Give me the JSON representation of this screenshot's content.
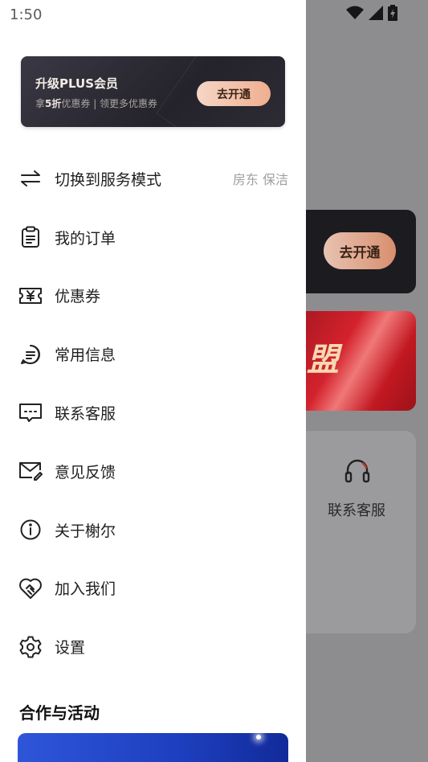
{
  "status_bar": {
    "time": "1:50"
  },
  "plus_banner": {
    "title": "升级PLUS会员",
    "subtitle_prefix": "拿",
    "subtitle_highlight": "5折",
    "subtitle_suffix": "优惠券 | 领更多优惠券",
    "button_label": "去开通"
  },
  "menu": {
    "items": [
      {
        "label": "切换到服务模式",
        "right_text": "房东 保洁",
        "icon": "switch-arrows-icon"
      },
      {
        "label": "我的订单",
        "icon": "clipboard-icon"
      },
      {
        "label": "优惠券",
        "icon": "coupon-yen-icon"
      },
      {
        "label": "常用信息",
        "icon": "chat-lines-icon"
      },
      {
        "label": "联系客服",
        "icon": "message-dots-icon"
      },
      {
        "label": "意见反馈",
        "icon": "mail-edit-icon"
      },
      {
        "label": "关于榭尔",
        "icon": "info-icon"
      },
      {
        "label": "加入我们",
        "icon": "handshake-heart-icon"
      },
      {
        "label": "设置",
        "icon": "gear-icon"
      }
    ]
  },
  "section": {
    "title": "合作与活动"
  },
  "background": {
    "open_button_label": "去开通",
    "promo_text": "盟",
    "service_label": "联系客服"
  }
}
